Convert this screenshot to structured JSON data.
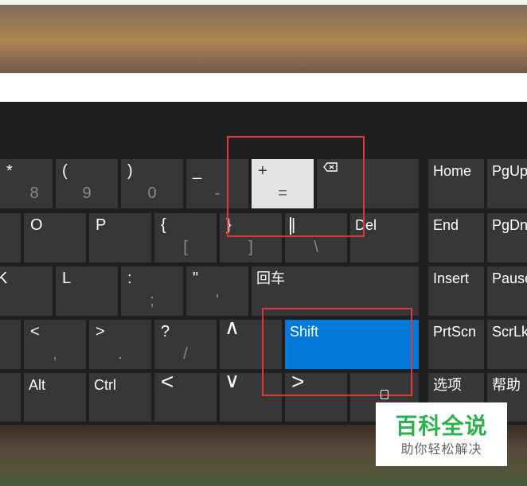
{
  "window": {
    "minimize_glyph": "–"
  },
  "keys": {
    "row1": [
      {
        "id": "asterisk-8",
        "top": "*",
        "bottom": "8"
      },
      {
        "id": "lparen-9",
        "top": "(",
        "bottom": "9"
      },
      {
        "id": "rparen-0",
        "top": ")",
        "bottom": "0"
      },
      {
        "id": "underscore-minus",
        "top": "_",
        "bottom": "-"
      },
      {
        "id": "plus-equals",
        "top": "+",
        "bottom": "="
      }
    ],
    "row1_nav": [
      {
        "id": "home",
        "label": "Home"
      },
      {
        "id": "pgup",
        "label": "PgUp"
      }
    ],
    "row2": [
      {
        "id": "o",
        "top": "O"
      },
      {
        "id": "p",
        "top": "P"
      },
      {
        "id": "lbrace",
        "top": "{",
        "bottom": "["
      },
      {
        "id": "rbrace",
        "top": "}",
        "bottom": "]"
      },
      {
        "id": "pipe",
        "top": "|",
        "bottom": "\\"
      },
      {
        "id": "del",
        "label": "Del"
      }
    ],
    "row2_nav": [
      {
        "id": "end",
        "label": "End"
      },
      {
        "id": "pgdn",
        "label": "PgDn"
      }
    ],
    "row3": [
      {
        "id": "k",
        "top": "K"
      },
      {
        "id": "l",
        "top": "L"
      },
      {
        "id": "colon",
        "top": ":",
        "bottom": ";"
      },
      {
        "id": "quote",
        "top": "\"",
        "bottom": "'"
      },
      {
        "id": "enter",
        "label": "回车"
      }
    ],
    "row3_nav": [
      {
        "id": "insert",
        "label": "Insert"
      },
      {
        "id": "pause",
        "label": "Pause"
      }
    ],
    "row4": [
      {
        "id": "lt",
        "top": "<",
        "bottom": ","
      },
      {
        "id": "gt",
        "top": ">",
        "bottom": "."
      },
      {
        "id": "question",
        "top": "?",
        "bottom": "/"
      },
      {
        "id": "up",
        "mid": "∧"
      },
      {
        "id": "shift",
        "label": "Shift"
      }
    ],
    "row4_nav": [
      {
        "id": "prtscn",
        "label": "PrtScn"
      },
      {
        "id": "scrlk",
        "label": "ScrLk"
      }
    ],
    "row5": [
      {
        "id": "alt",
        "label": "Alt"
      },
      {
        "id": "ctrl",
        "label": "Ctrl"
      },
      {
        "id": "left",
        "mid": "<"
      },
      {
        "id": "down",
        "mid": "∨"
      },
      {
        "id": "right",
        "mid": ">"
      }
    ],
    "row5_nav": [
      {
        "id": "options",
        "label": "选项"
      },
      {
        "id": "help",
        "label": "帮助"
      }
    ]
  },
  "watermark": {
    "title": "百科全说",
    "subtitle": "助你轻松解决"
  },
  "colors": {
    "accent": "#0078d7",
    "highlight": "#e0383a",
    "watermark_green": "#2bb24c"
  }
}
